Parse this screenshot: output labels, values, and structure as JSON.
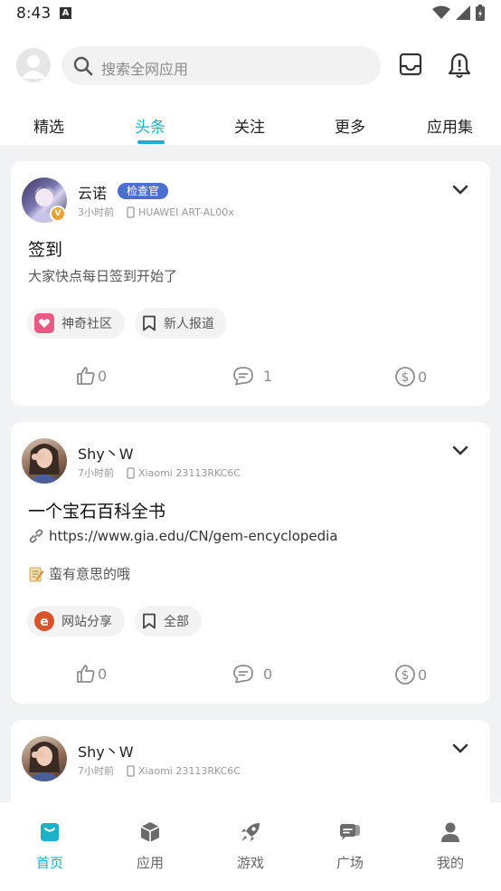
{
  "status_bar": {
    "time": "8:43",
    "notification_letter": "A"
  },
  "header": {
    "search_placeholder": "搜索全网应用"
  },
  "tabs": [
    {
      "label": "精选"
    },
    {
      "label": "头条"
    },
    {
      "label": "关注"
    },
    {
      "label": "更多"
    },
    {
      "label": "应用集"
    }
  ],
  "posts": [
    {
      "username": "云诺",
      "role_tag": "检查官",
      "verified_badge": "V",
      "time": "3小时前",
      "device": "HUAWEI ART-AL00x",
      "title": "签到",
      "body": "大家快点每日签到开始了",
      "chips": [
        {
          "label": "神奇社区"
        },
        {
          "label": "新人报道"
        }
      ],
      "likes": "0",
      "comments": "1",
      "coins": "0"
    },
    {
      "username": "Shy丶W",
      "time": "7小时前",
      "device": "Xiaomi 23113RKC6C",
      "title": "一个宝石百科全书",
      "link": "https://www.gia.edu/CN/gem-encyclopedia",
      "note": "蛮有意思的哦",
      "chips": [
        {
          "label": "网站分享"
        },
        {
          "label": "全部"
        }
      ],
      "likes": "0",
      "comments": "0",
      "coins": "0"
    },
    {
      "username": "Shy丶W",
      "time": "7小时前",
      "device": "Xiaomi 23113RKC6C"
    }
  ],
  "bottom_nav": [
    {
      "label": "首页",
      "icon": "home-bag-icon",
      "active": true
    },
    {
      "label": "应用",
      "icon": "cube-icon"
    },
    {
      "label": "游戏",
      "icon": "rocket-icon"
    },
    {
      "label": "广场",
      "icon": "chat-bubbles-icon"
    },
    {
      "label": "我的",
      "icon": "person-icon"
    }
  ],
  "colors": {
    "accent": "#1bb2c9",
    "role_tag": "#4b6fcf",
    "verified_badge": "#e6a536"
  }
}
